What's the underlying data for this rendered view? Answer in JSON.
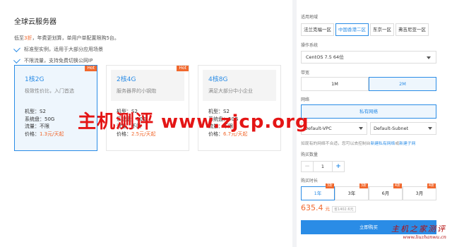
{
  "main": {
    "title": "全球云服务器",
    "promo_prefix": "低至",
    "promo_highlight": "3折",
    "promo_suffix": "，年费更划算，单用户单配置限购5台。",
    "features": [
      "标准型实例，适用于大部分应用场景",
      "不限流量，支持免费切换公网IP"
    ],
    "cards": [
      {
        "name": "1核2G",
        "desc": "极致性价比，入门首选",
        "badge": "Hot",
        "model": "机型：S2",
        "disk": "系统盘：50G",
        "traffic": "流量：不限",
        "price_prefix": "价格：",
        "price": "1.3元/天起",
        "selected": true
      },
      {
        "name": "2核4G",
        "desc": "服务器界的小钢炮",
        "badge": "Hot",
        "model": "机型：S2",
        "disk": "系统盘：50G",
        "traffic": "流量：不限",
        "price_prefix": "价格：",
        "price": "2.5元/天起",
        "selected": false
      },
      {
        "name": "4核8G",
        "desc": "满足大部分中小企业",
        "badge": "",
        "model": "机型：S2",
        "disk": "系统盘：50G",
        "traffic": "流量：不限",
        "price_prefix": "价格：",
        "price": "6.7元/天起",
        "selected": false
      }
    ]
  },
  "config": {
    "region_label": "适用地域",
    "regions": [
      "法兰克福一区",
      "中国香港二区",
      "东京一区",
      "弗吉尼亚一区"
    ],
    "selected_region": 1,
    "os_label": "操作系统",
    "os_value": "CentOS 7.5 64位",
    "bandwidth_label": "带宽",
    "bandwidth": [
      "1M",
      "2M"
    ],
    "selected_bandwidth": 1,
    "network_label": "网络",
    "network_type": "私有网络",
    "vpc_value": "Default-VPC",
    "subnet_value": "Default-Subnet",
    "network_note": "如现有的网络不合适，您可以去控制台",
    "create_vpc_link": "新建私有网络",
    "note_or": "或",
    "create_subnet_link": "新建子网",
    "quantity_label": "购买数量",
    "quantity": "1",
    "minus": "−",
    "plus": "+",
    "duration_label": "购买时长",
    "durations": [
      {
        "label": "1年",
        "tag": "3折"
      },
      {
        "label": "3年",
        "tag": "3折"
      },
      {
        "label": "6月",
        "tag": "4折"
      },
      {
        "label": "3月",
        "tag": "4折"
      }
    ],
    "selected_duration": 0,
    "total_amount": "635.4",
    "total_unit": "元",
    "original_price": "省1402.6元",
    "buy_label": "立即购买"
  },
  "watermark": {
    "main": "主机测评 www.zjcp.org",
    "corner_cn": "主机之家测评",
    "corner_url": "www.liuzhanwu.cn"
  }
}
